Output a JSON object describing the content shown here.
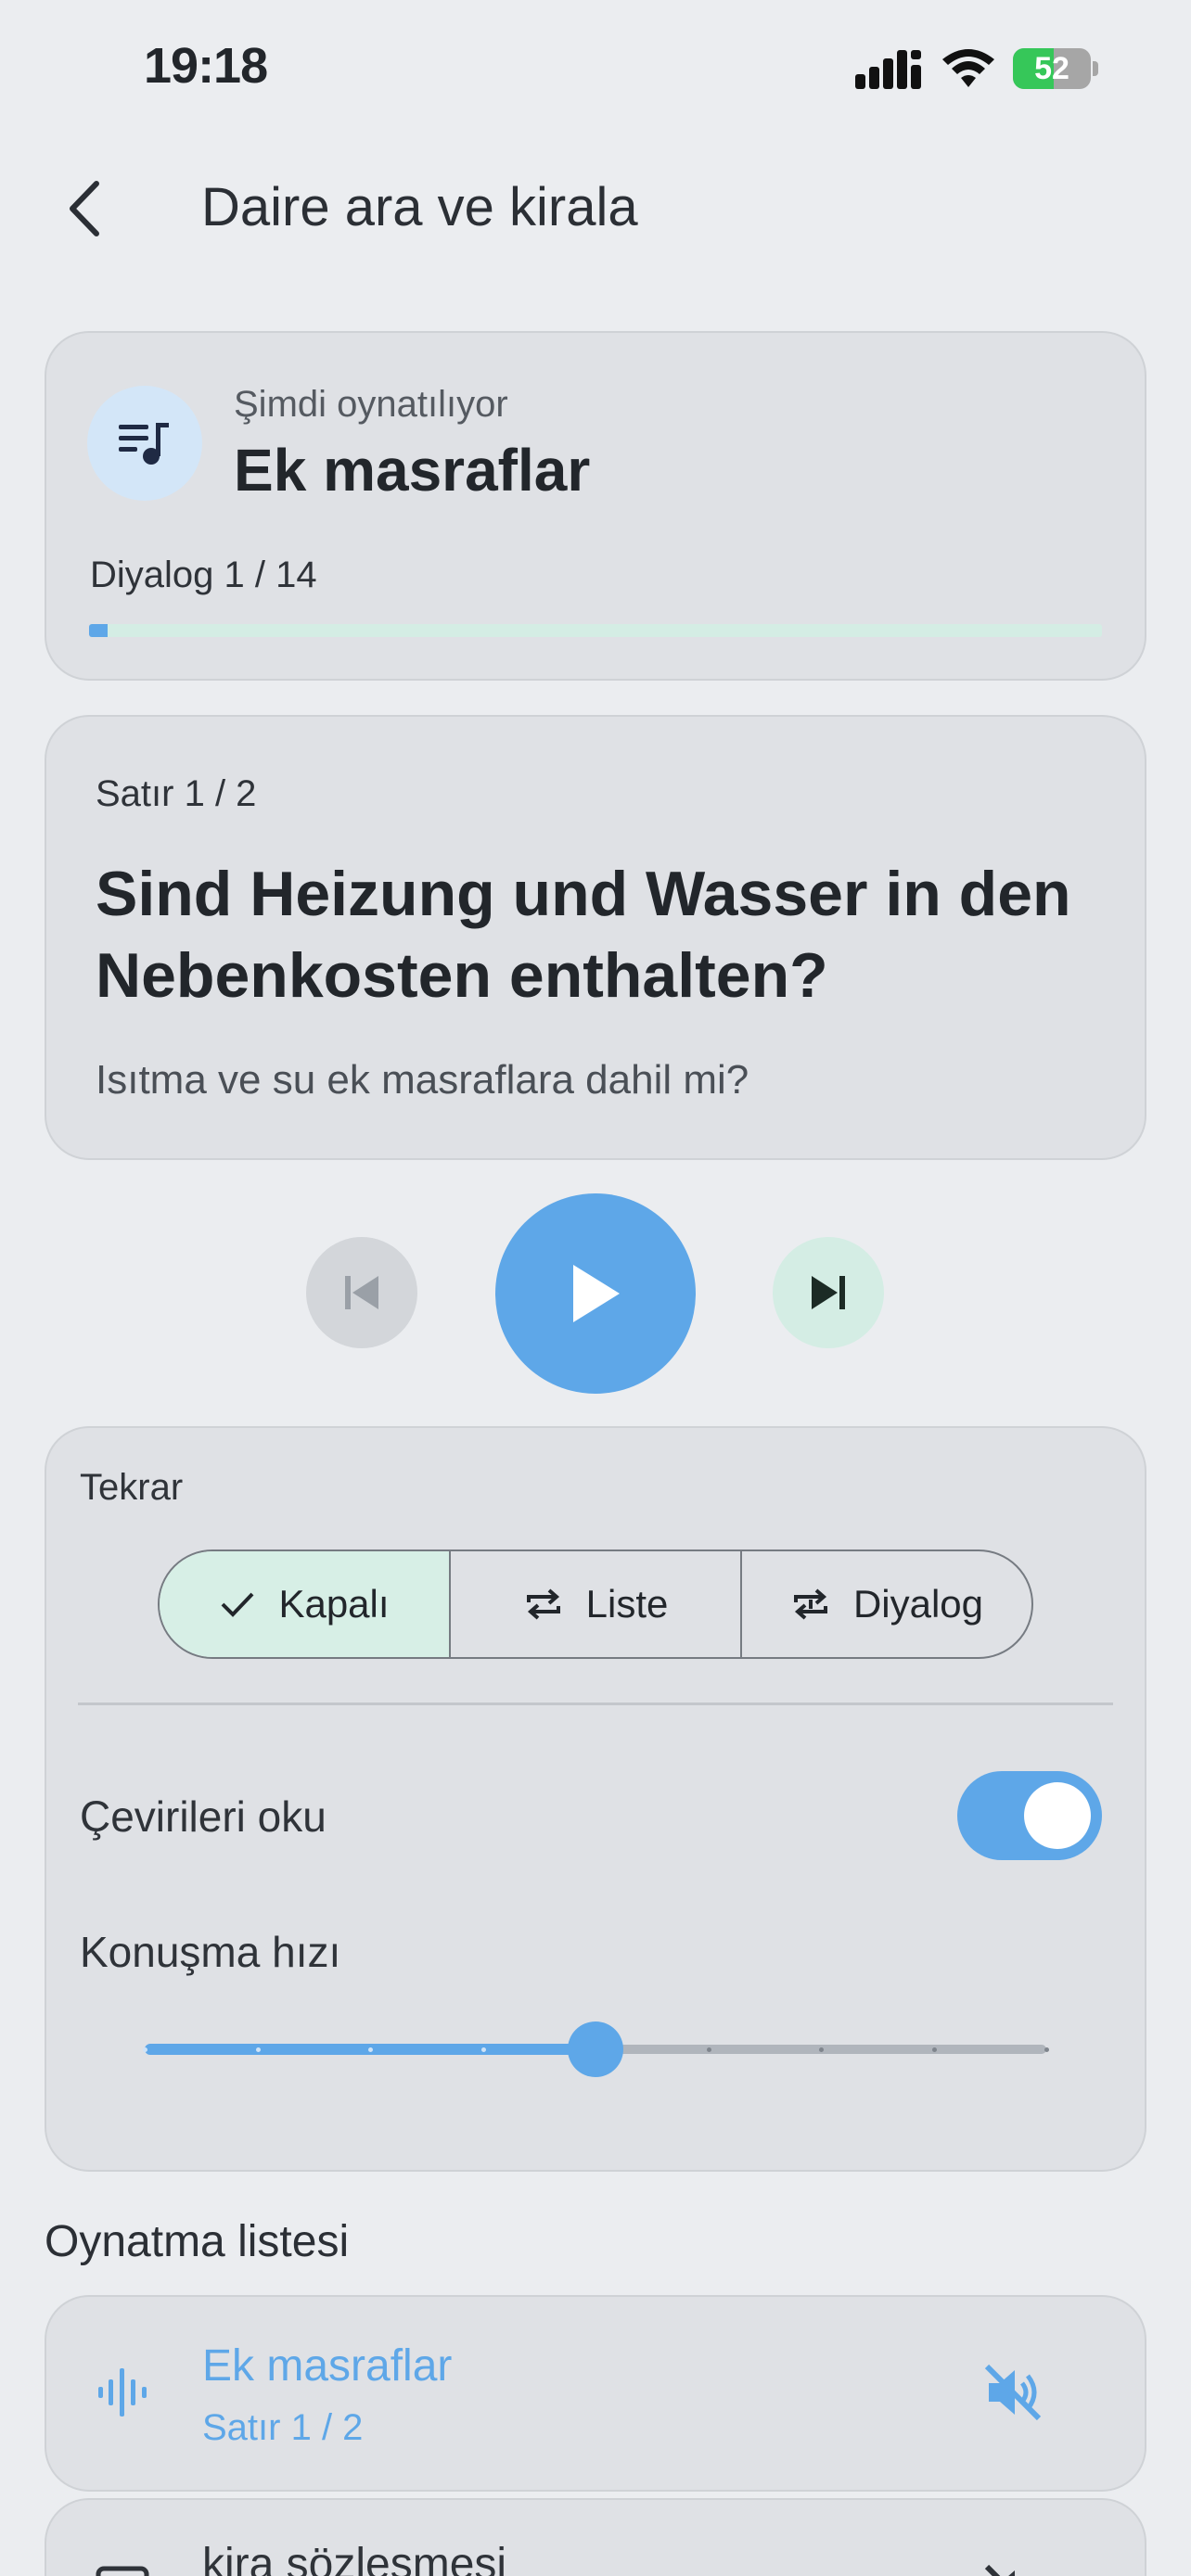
{
  "status_bar": {
    "time": "19:18",
    "battery_level": "52",
    "battery_percent": 52,
    "icons": [
      "signal-icon",
      "wifi-icon",
      "battery-charging-icon"
    ]
  },
  "header": {
    "back_icon": "chevron-left-icon",
    "title": "Daire ara ve kirala"
  },
  "now_playing": {
    "icon": "queue-music-icon",
    "label": "Şimdi oynatılıyor",
    "title": "Ek masraflar",
    "progress_label": "Diyalog 1 / 14",
    "progress_current": 1,
    "progress_total": 14
  },
  "current_line": {
    "counter": "Satır 1 / 2",
    "german": "Sind Heizung und Wasser in den Nebenkosten enthalten?",
    "translation": "Isıtma ve su ek masraflara dahil mi?"
  },
  "controls": {
    "prev_icon": "skip-previous-icon",
    "play_icon": "play-icon",
    "next_icon": "skip-next-icon"
  },
  "settings": {
    "repeat_label": "Tekrar",
    "repeat_options": [
      {
        "label": "Kapalı",
        "icon": "check-icon",
        "selected": true
      },
      {
        "label": "Liste",
        "icon": "repeat-icon",
        "selected": false
      },
      {
        "label": "Diyalog",
        "icon": "repeat-one-icon",
        "selected": false
      }
    ],
    "read_translations_label": "Çevirileri oku",
    "read_translations_on": true,
    "speech_rate_label": "Konuşma hızı",
    "speech_rate_steps": 9,
    "speech_rate_value_index": 4
  },
  "playlist": {
    "title": "Oynatma listesi",
    "items": [
      {
        "title": "Ek masraflar",
        "subtitle": "Satır 1 / 2",
        "icon": "audio-wave-icon",
        "action_icon": "volume-off-icon",
        "active": true
      },
      {
        "title": "kira sözleşmesi",
        "subtitle": "",
        "icon": "document-icon",
        "action_icon": "volume-off-icon",
        "active": false
      }
    ]
  },
  "colors": {
    "accent": "#5ea7e8",
    "mint": "#d7efe6",
    "card": "#dfe1e5",
    "background": "#ebedf0"
  }
}
